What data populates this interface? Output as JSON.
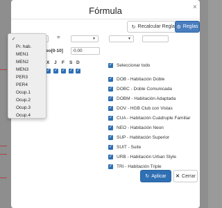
{
  "modal": {
    "title": "Fórmula",
    "close_symbol": "×"
  },
  "toolbar": {
    "recalc_label": "Recalcular Reglas",
    "rules_label": "Reglas"
  },
  "formula_row": {
    "equals": "="
  },
  "value_row": {
    "label": "eo[0-10]",
    "value": "0.00"
  },
  "days_row": {
    "letters": [
      "X",
      "J",
      "F",
      "S",
      "D"
    ]
  },
  "dropdown": {
    "selected_mark": "✓",
    "options": [
      "Pr. hab.",
      "MEN1",
      "MEN2",
      "MEN3",
      "PER3",
      "PER4",
      "Ocup.1",
      "Ocup.2",
      "Ocup.3",
      "Ocup.4"
    ]
  },
  "rooms": {
    "select_all_label": "Seleccionar todo",
    "items": [
      "DOB - Habitación Doble",
      "DOBC - Doble Comunicada",
      "DOBM - Habitación Adaptada",
      "DOV - HGB Club con Vistas",
      "CUA - Habitación Cuádruple Familiar",
      "NEO - Habitación Neon",
      "SUP - Habitación Superior",
      "SUIT - Suite",
      "URB - Habitación Urban Style",
      "TRI - Habitación Triple"
    ]
  },
  "footer": {
    "apply_label": "Aplicar",
    "close_label": "Cerrar"
  },
  "colors": {
    "primary": "#2f6fb3",
    "overlay": "#9a9a9a"
  }
}
